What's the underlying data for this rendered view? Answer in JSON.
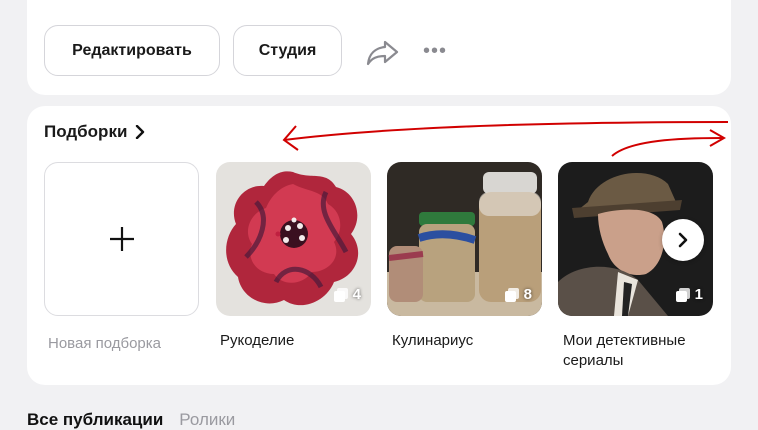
{
  "profile_actions": {
    "edit_label": "Редактировать",
    "studio_label": "Студия",
    "share_icon": "share-arrow-icon",
    "more_icon": "more-dots-icon",
    "more_glyph": "•••"
  },
  "collections": {
    "title": "Подборки",
    "new_label": "Новая подборка",
    "items": [
      {
        "label": "Рукоделие",
        "count": "4"
      },
      {
        "label": "Кулинариус",
        "count": "8"
      },
      {
        "label": "Мои детективные сериалы",
        "count": "1"
      }
    ]
  },
  "tabs": {
    "all_publications": "Все публикации",
    "videos": "Ролики"
  },
  "colors": {
    "background": "#f1f1f3",
    "card": "#ffffff",
    "annotation": "#d10000"
  }
}
